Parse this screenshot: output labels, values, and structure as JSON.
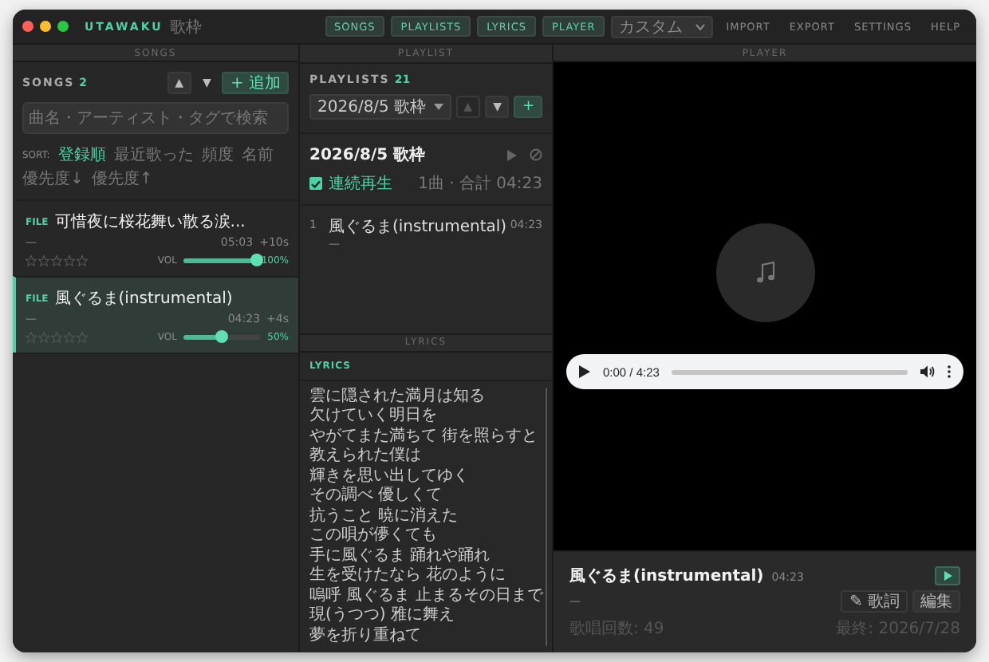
{
  "window": {
    "title": "UTAWAKU",
    "subtitle": "歌枠"
  },
  "nav": {
    "buttons": [
      {
        "label": "SONGS"
      },
      {
        "label": "PLAYLISTS"
      },
      {
        "label": "LYRICS"
      },
      {
        "label": "PLAYER"
      }
    ],
    "dropdown": {
      "value": "カスタム"
    },
    "links": [
      "IMPORT",
      "EXPORT",
      "SETTINGS",
      "HELP"
    ]
  },
  "songs_panel": {
    "header": "SONGS",
    "title": "SONGS",
    "count": "2",
    "up_button": "▲",
    "down_button": "▼",
    "add_button": "+ 追加",
    "search": {
      "placeholder": "曲名・アーティスト・タグで検索"
    },
    "sort": {
      "label": "SORT:",
      "options": [
        {
          "label": "登録順",
          "selected": true
        },
        {
          "label": "最近歌った",
          "selected": false
        },
        {
          "label": "頻度",
          "selected": false
        },
        {
          "label": "名前",
          "selected": false
        },
        {
          "label": "優先度↓",
          "selected": false
        },
        {
          "label": "優先度↑",
          "selected": false
        }
      ]
    },
    "songs": [
      {
        "badge": "FILE",
        "title": "可惜夜に桜花舞い散る涙...",
        "artist": "—",
        "duration": "05:03",
        "offset": "+10s",
        "stars": 0,
        "volume_label": "VOL",
        "level": 0.95,
        "volume": "100%",
        "selected": false
      },
      {
        "badge": "FILE",
        "title": "風ぐるま(instrumental)",
        "artist": "—",
        "duration": "04:23",
        "offset": "+4s",
        "stars": 0,
        "volume_label": "VOL",
        "level": 0.5,
        "volume": "50%",
        "selected": true
      }
    ]
  },
  "playlist_panel": {
    "header": "PLAYLIST",
    "title": "PLAYLISTS",
    "count": "21",
    "select": {
      "value": "2026/8/5 歌枠"
    },
    "up_button": "▲",
    "down_button": "▼",
    "add_button": "+",
    "playlist": {
      "name": "2026/8/5 歌枠",
      "autoplay": {
        "label": "連続再生",
        "checked": true
      },
      "summary": "1曲 · 合計 04:23",
      "items": [
        {
          "number": "1",
          "title": "風ぐるま(instrumental)",
          "artist": "—",
          "duration": "04:23"
        }
      ]
    }
  },
  "lyrics_panel": {
    "header": "LYRICS",
    "title": "LYRICS",
    "lines": [
      "雲に隠された満月は知る",
      "欠けていく明日を",
      "やがてまた満ちて 街を照らすと",
      "教えられた僕は",
      "輝きを思い出してゆく",
      "その調べ 優しくて",
      "抗うこと 暁に消えた",
      "この唄が儚くても",
      "手に風ぐるま 踊れや踊れ",
      "生を受けたなら 花のように",
      "嗚呼 風ぐるま 止まるその日まで",
      "現(うつつ) 雅に舞え",
      "夢を折り重ねて"
    ]
  },
  "player_panel": {
    "header": "PLAYER",
    "audio": {
      "time": "0:00 / 4:23",
      "level": 0
    },
    "now_playing": {
      "title": "風ぐるま(instrumental)",
      "duration": "04:23",
      "artist": "—",
      "lyrics_button": "✎ 歌詞",
      "edit_button": "編集",
      "play_count": "歌唱回数: 49",
      "last_sung": "最終: 2026/7/28"
    }
  }
}
